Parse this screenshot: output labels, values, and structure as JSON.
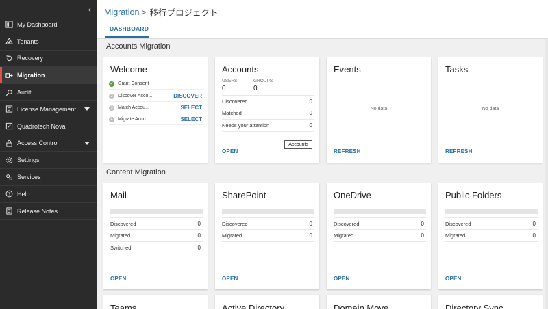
{
  "sidebar": {
    "collapse_glyph": "‹",
    "items": [
      {
        "label": "My Dashboard",
        "icon": "dashboard-icon"
      },
      {
        "label": "Tenants",
        "icon": "tenants-icon"
      },
      {
        "label": "Recovery",
        "icon": "recovery-icon"
      },
      {
        "label": "Migration",
        "icon": "migration-icon",
        "active": true
      },
      {
        "label": "Audit",
        "icon": "audit-icon"
      },
      {
        "label": "License Management",
        "icon": "license-icon",
        "dropdown": true
      },
      {
        "label": "Quadrotech Nova",
        "icon": "nova-icon"
      },
      {
        "label": "Access Control",
        "icon": "access-control-icon",
        "dropdown": true
      },
      {
        "label": "Settings",
        "icon": "settings-icon"
      },
      {
        "label": "Services",
        "icon": "services-icon"
      },
      {
        "label": "Help",
        "icon": "help-icon"
      },
      {
        "label": "Release Notes",
        "icon": "release-notes-icon"
      }
    ]
  },
  "header": {
    "breadcrumb_root": "Migration",
    "breadcrumb_sep": ">",
    "breadcrumb_current": "移行プロジェクト",
    "tab": "DASHBOARD"
  },
  "accounts_migration": {
    "title": "Accounts Migration",
    "welcome": {
      "title": "Welcome",
      "steps": [
        {
          "label": "Grant Consent",
          "action": "",
          "state": "done",
          "num": "✓"
        },
        {
          "label": "Discover Acco...",
          "action": "DISCOVER",
          "state": "pending",
          "num": "2"
        },
        {
          "label": "Match Accou...",
          "action": "SELECT",
          "state": "pending",
          "num": "3"
        },
        {
          "label": "Migrate Acco...",
          "action": "SELECT",
          "state": "pending",
          "num": "4"
        }
      ]
    },
    "accounts": {
      "title": "Accounts",
      "users_label": "USERS",
      "users_value": "0",
      "groups_label": "GROUPS",
      "groups_value": "0",
      "rows": [
        {
          "label": "Discovered",
          "value": "0"
        },
        {
          "label": "Matched",
          "value": "0"
        },
        {
          "label": "Needs your attention",
          "value": "0"
        }
      ],
      "action": "OPEN",
      "button": "Accounts"
    },
    "events": {
      "title": "Events",
      "nodata": "No data",
      "action": "REFRESH"
    },
    "tasks": {
      "title": "Tasks",
      "nodata": "No data",
      "action": "REFRESH"
    }
  },
  "content_migration": {
    "title": "Content Migration",
    "mail": {
      "title": "Mail",
      "rows": [
        {
          "label": "Discovered",
          "value": "0"
        },
        {
          "label": "Migrated",
          "value": "0"
        },
        {
          "label": "Switched",
          "value": "0"
        }
      ],
      "action": "OPEN"
    },
    "sharepoint": {
      "title": "SharePoint",
      "rows": [
        {
          "label": "Discovered",
          "value": "0"
        },
        {
          "label": "Migrated",
          "value": "0"
        }
      ],
      "action": "OPEN"
    },
    "onedrive": {
      "title": "OneDrive",
      "rows": [
        {
          "label": "Discovered",
          "value": "0"
        },
        {
          "label": "Migrated",
          "value": "0"
        }
      ],
      "action": "OPEN"
    },
    "public_folders": {
      "title": "Public Folders",
      "rows": [
        {
          "label": "Discovered",
          "value": "0"
        },
        {
          "label": "Migrated",
          "value": "0"
        }
      ],
      "action": "OPEN"
    }
  },
  "bottom_cards": [
    "Teams",
    "Active Directory",
    "Domain Move",
    "Directory Sync"
  ],
  "colors": {
    "accent": "#2a6fa8",
    "sidebar_bg": "#2b2b2b",
    "active_marker": "#d9534f",
    "done": "#5a9b46"
  }
}
